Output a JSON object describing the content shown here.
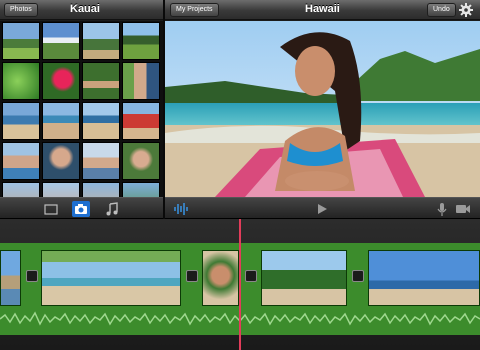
{
  "left_bar": {
    "photos_button": "Photos",
    "title": "Kauai"
  },
  "right_bar": {
    "projects_button": "My Projects",
    "title": "Hawaii",
    "undo_button": "Undo"
  },
  "media_tools": [
    "filmstrip-icon",
    "camera-icon",
    "music-note-icon"
  ],
  "viewer_tools": [
    "audio-waveform-icon",
    "play-icon",
    "microphone-icon",
    "video-camera-icon"
  ],
  "colors": {
    "accent": "#1e6fd0",
    "track": "#3c8c2c",
    "playhead": "#e23c5a"
  }
}
